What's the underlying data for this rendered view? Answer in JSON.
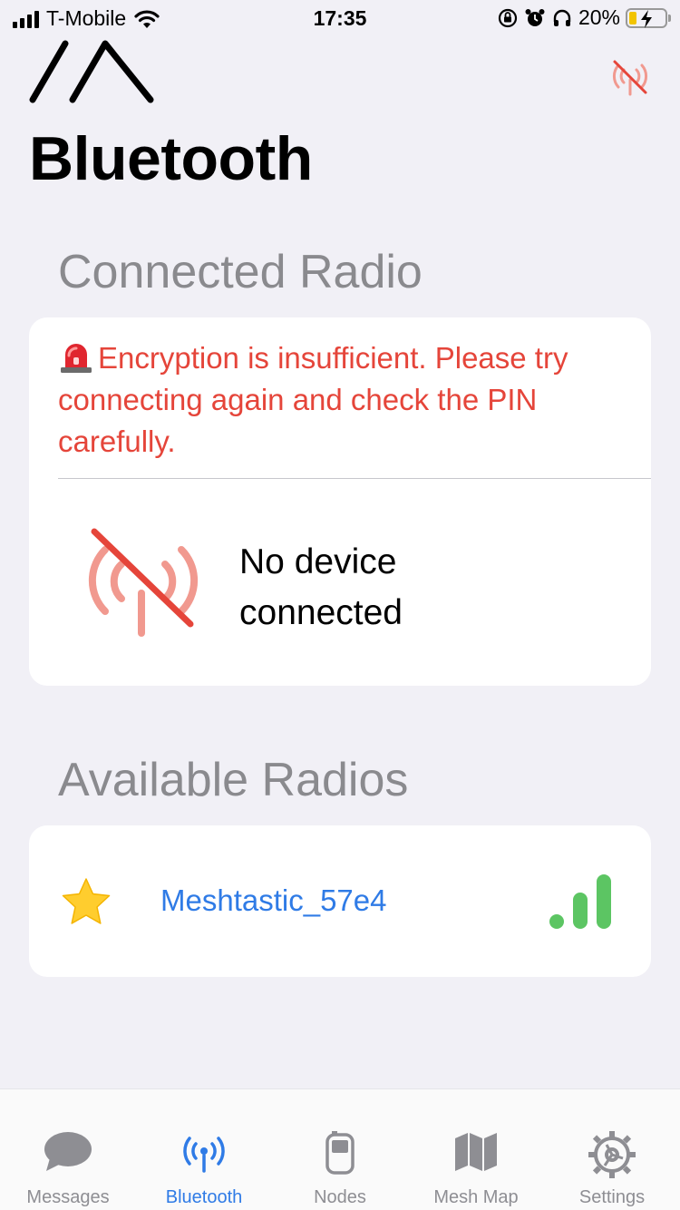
{
  "status_bar": {
    "carrier": "T-Mobile",
    "time": "17:35",
    "battery_percent": "20%"
  },
  "header": {
    "title": "Bluetooth"
  },
  "connected_section": {
    "title": "Connected Radio",
    "alert_text": "Encryption is insufficient. Please try connecting again and check the PIN carefully.",
    "no_device_text": "No device connected"
  },
  "available_section": {
    "title": "Available Radios",
    "radios": [
      {
        "name": "Meshtastic_57e4",
        "favorite": true,
        "signal_bars": 3
      }
    ]
  },
  "tab_bar": {
    "tabs": [
      {
        "label": "Messages",
        "icon": "chat-bubble-icon",
        "active": false
      },
      {
        "label": "Bluetooth",
        "icon": "antenna-icon",
        "active": true
      },
      {
        "label": "Nodes",
        "icon": "handheld-device-icon",
        "active": false
      },
      {
        "label": "Mesh Map",
        "icon": "map-icon",
        "active": false
      },
      {
        "label": "Settings",
        "icon": "gear-icon",
        "active": false
      }
    ]
  },
  "colors": {
    "accent": "#2f7be6",
    "alert": "#e5453a",
    "signal": "#5cc563",
    "background": "#f1f0f6"
  }
}
